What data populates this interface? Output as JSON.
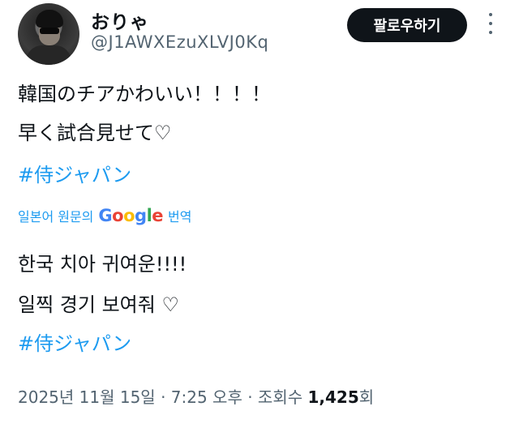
{
  "author": {
    "display_name": "おりゃ",
    "handle": "@J1AWXEzuXLVJ0Kq"
  },
  "follow_button": {
    "label": "팔로우하기"
  },
  "tweet": {
    "original": {
      "line1": "韓国のチアかわいい！！！！",
      "line2": "早く試合見せて♡",
      "hashtag": "#侍ジャパン"
    },
    "translation_bar": {
      "prefix": "일본어 원문의",
      "google_logo": {
        "G": "G",
        "o1": "o",
        "o2": "o",
        "g": "g",
        "l": "l",
        "e": "e"
      },
      "action": "번역"
    },
    "translated": {
      "line1": "한국 치아 귀여운!!!!",
      "line2": "일찍 경기 보여줘 ♡",
      "hashtag": "#侍ジャパン"
    }
  },
  "meta": {
    "date": "2025년 11월 15일 · 7:25 오후 · 조회수 ",
    "views": "1,425",
    "views_suffix": "회"
  },
  "colors": {
    "link": "#1d9bf0",
    "text": "#0f1419",
    "secondary": "#536471",
    "button_bg": "#0f1419"
  },
  "icons": [
    "avatar",
    "more-horizontal-icon"
  ]
}
